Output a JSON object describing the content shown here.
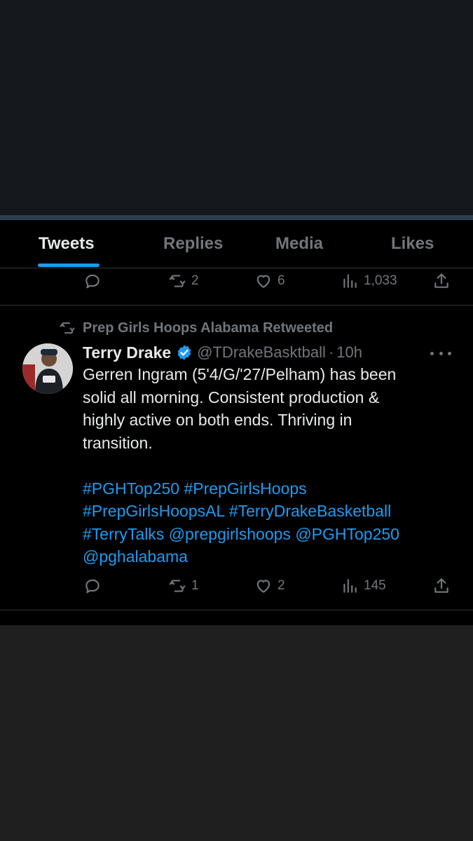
{
  "tabs": [
    {
      "label": "Tweets",
      "active": true
    },
    {
      "label": "Replies",
      "active": false
    },
    {
      "label": "Media",
      "active": false
    },
    {
      "label": "Likes",
      "active": false
    }
  ],
  "previous_tweet": {
    "retweets": "2",
    "likes": "6",
    "views": "1,033"
  },
  "tweet": {
    "retweeted_by": "Prep Girls Hoops Alabama Retweeted",
    "display_name": "Terry Drake",
    "handle": "@TDrakeBasktball",
    "separator": "·",
    "time": "10h",
    "text_lines": [
      "Gerren Ingram (5'4/G/'27/Pelham) has been",
      "solid all morning. Consistent production &",
      "highly active on both ends. Thriving in",
      "transition."
    ],
    "tags_line1": [
      "#PGHTop250",
      "#PrepGirlsHoops"
    ],
    "tags_line2": [
      "#PrepGirlsHoopsAL",
      "#TerryDrakeBasketball"
    ],
    "tags_line3": [
      "#TerryTalks",
      "@prepgirlshoops",
      "@PGHTop250"
    ],
    "tags_line4": [
      "@pghalabama"
    ],
    "retweets": "1",
    "likes": "2",
    "views": "145"
  },
  "colors": {
    "accent": "#1d9bf0",
    "text": "#e7e9ea",
    "muted": "#71767b",
    "panel": "#000000"
  },
  "icons": [
    "reply-icon",
    "retweet-icon",
    "like-icon",
    "views-icon",
    "share-icon",
    "verified-icon",
    "more-icon"
  ]
}
